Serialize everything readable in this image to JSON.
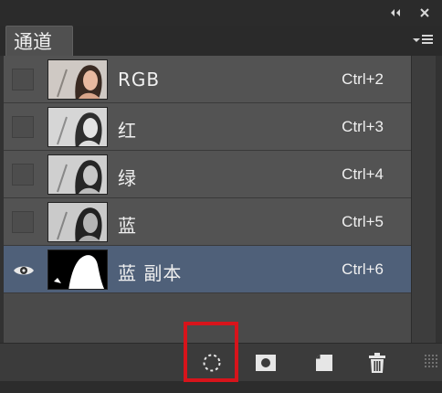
{
  "panel": {
    "tab_label": "通道"
  },
  "channels": [
    {
      "name": "RGB",
      "shortcut": "Ctrl+2",
      "visible": false,
      "thumb": "color"
    },
    {
      "name": "红",
      "shortcut": "Ctrl+3",
      "visible": false,
      "thumb": "gray"
    },
    {
      "name": "绿",
      "shortcut": "Ctrl+4",
      "visible": false,
      "thumb": "gray"
    },
    {
      "name": "蓝",
      "shortcut": "Ctrl+5",
      "visible": false,
      "thumb": "gray"
    },
    {
      "name": "蓝 副本",
      "shortcut": "Ctrl+6",
      "visible": true,
      "thumb": "mask",
      "selected": true
    }
  ],
  "icons": {
    "collapse": "double-chevron-left-icon",
    "close": "close-icon",
    "panel_menu": "panel-menu-icon",
    "eye": "eye-icon",
    "load_selection": "load-channel-as-selection-icon",
    "save_selection": "save-selection-as-channel-icon",
    "new_channel": "new-channel-icon",
    "delete": "trash-icon"
  },
  "colors": {
    "selected_row": "#4f6079",
    "highlight": "#d7141b"
  }
}
